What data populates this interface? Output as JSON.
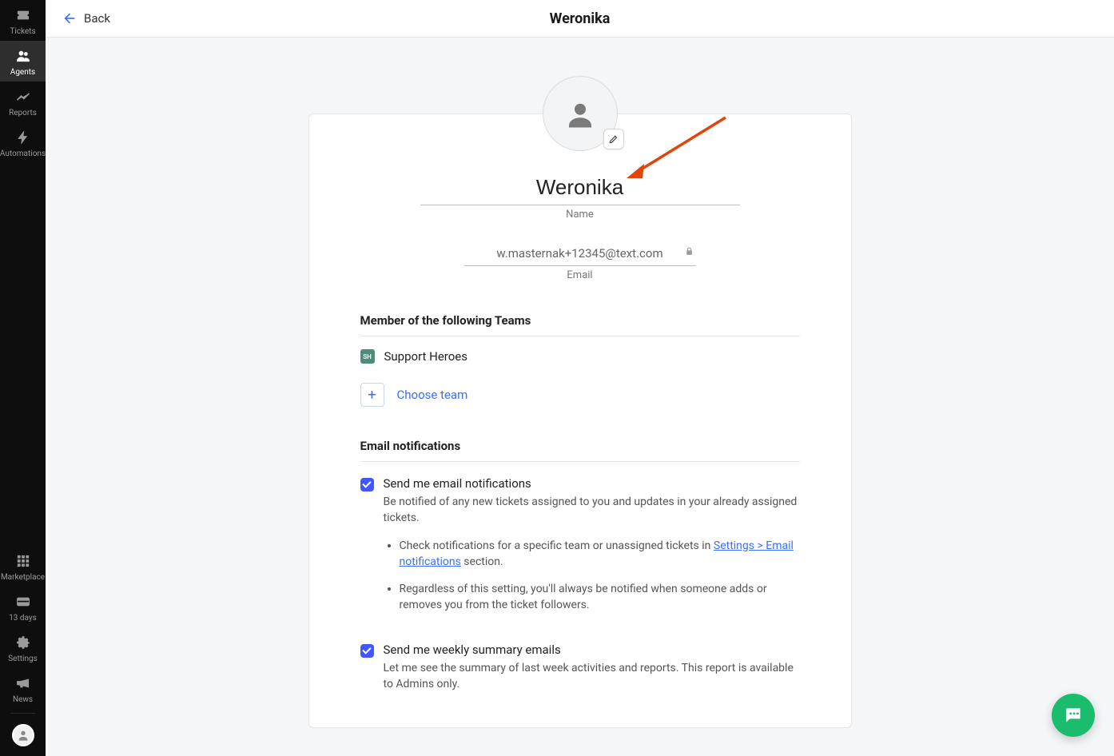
{
  "sidebar": {
    "top": [
      {
        "id": "tickets",
        "label": "Tickets"
      },
      {
        "id": "agents",
        "label": "Agents"
      },
      {
        "id": "reports",
        "label": "Reports"
      },
      {
        "id": "automations",
        "label": "Automations"
      }
    ],
    "bottom": [
      {
        "id": "marketplace",
        "label": "Marketplace"
      },
      {
        "id": "trial",
        "label": "13 days"
      },
      {
        "id": "settings",
        "label": "Settings"
      },
      {
        "id": "news",
        "label": "News"
      }
    ],
    "active": "agents"
  },
  "header": {
    "back_label": "Back",
    "title": "Weronika"
  },
  "profile": {
    "name_value": "Weronika",
    "name_caption": "Name",
    "email_value": "w.masternak+12345@text.com",
    "email_caption": "Email"
  },
  "teams": {
    "section_title": "Member of the following Teams",
    "items": [
      {
        "badge": "SH",
        "name": "Support Heroes"
      }
    ],
    "choose_label": "Choose team"
  },
  "notifications": {
    "section_title": "Email notifications",
    "items": [
      {
        "title": "Send me email notifications",
        "desc": "Be notified of any new tickets assigned to you and updates in your already assigned tickets.",
        "checked": true,
        "bullets": [
          {
            "pre": "Check notifications for a specific team or unassigned tickets in ",
            "link": "Settings > Email notifications",
            "post": " section."
          },
          {
            "pre": "Regardless of this setting, you'll always be notified when someone adds or removes you from the ticket followers.",
            "link": "",
            "post": ""
          }
        ]
      },
      {
        "title": "Send me weekly summary emails",
        "desc": "Let me see the summary of last week activities and reports. This report is available to Admins only.",
        "checked": true
      }
    ]
  }
}
